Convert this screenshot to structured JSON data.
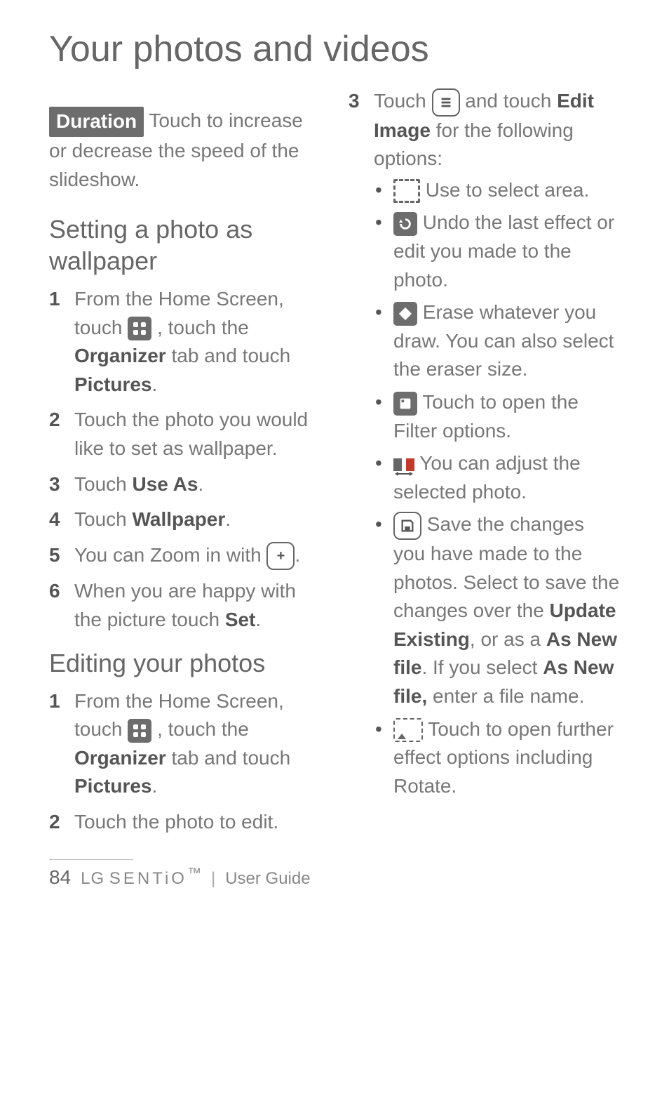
{
  "title": "Your photos and videos",
  "duration": {
    "chip": "Duration",
    "rest": " Touch to increase or decrease the speed of the slideshow."
  },
  "section_wallpaper": {
    "heading": "Setting a photo as wallpaper",
    "steps": {
      "s1a": "From the Home Screen, touch ",
      "s1b": " , touch the ",
      "s1_org": "Organizer",
      "s1c": " tab and touch ",
      "s1_pic": "Pictures",
      "s1d": ".",
      "s2": "Touch the photo you would like to set as wallpaper.",
      "s3a": "Touch ",
      "s3b": "Use As",
      "s3c": ".",
      "s4a": "Touch ",
      "s4b": "Wallpaper",
      "s4c": ".",
      "s5a": "You can Zoom in with ",
      "s5b": ".",
      "s6a": "When you are happy with the picture touch ",
      "s6b": "Set",
      "s6c": "."
    }
  },
  "section_edit": {
    "heading": "Editing your photos",
    "steps": {
      "s1a": "From the Home Screen, touch ",
      "s1b": " , touch the ",
      "s1_org": "Organizer",
      "s1c": " tab and touch ",
      "s1_pic": "Pictures",
      "s1d": ".",
      "s2": "Touch the photo to edit."
    }
  },
  "right": {
    "s3a": "Touch ",
    "s3b": " and touch ",
    "s3_edit": "Edit Image",
    "s3c": " for the following options:",
    "b1": " Use to select area.",
    "b2": " Undo the last effect or edit you made to the photo.",
    "b3": " Erase whatever you draw. You can also select the eraser size.",
    "b4": " Touch to open the Filter options.",
    "b5": " You can adjust the selected photo.",
    "b6a": " Save the changes you have made to the photos. Select to save the changes over the ",
    "b6_upd": "Update Existing",
    "b6b": ", or as a ",
    "b6_new1": "As New file",
    "b6c": ". If you select ",
    "b6_new2": "As New file,",
    "b6d": " enter a file name.",
    "b7": " Touch to open further effect options including Rotate."
  },
  "footer": {
    "page": "84",
    "brand_lg": "LG",
    "brand_sentio": "SENTiO",
    "tm": "™",
    "divider": "|",
    "guide": "User Guide"
  }
}
